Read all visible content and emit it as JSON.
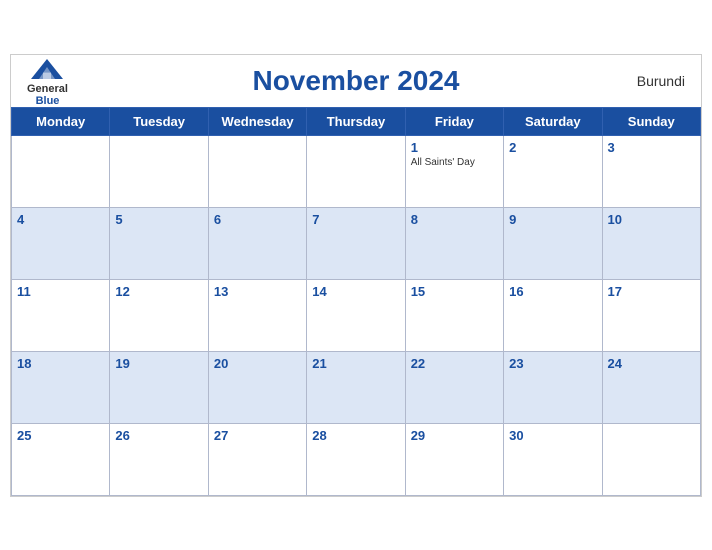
{
  "header": {
    "title": "November 2024",
    "country": "Burundi",
    "logo": {
      "general": "General",
      "blue": "Blue"
    }
  },
  "weekdays": [
    "Monday",
    "Tuesday",
    "Wednesday",
    "Thursday",
    "Friday",
    "Saturday",
    "Sunday"
  ],
  "weeks": [
    [
      {
        "day": "",
        "empty": true
      },
      {
        "day": "",
        "empty": true
      },
      {
        "day": "",
        "empty": true
      },
      {
        "day": "",
        "empty": true
      },
      {
        "day": "1",
        "event": "All Saints' Day"
      },
      {
        "day": "2"
      },
      {
        "day": "3"
      }
    ],
    [
      {
        "day": "4"
      },
      {
        "day": "5"
      },
      {
        "day": "6"
      },
      {
        "day": "7"
      },
      {
        "day": "8"
      },
      {
        "day": "9"
      },
      {
        "day": "10"
      }
    ],
    [
      {
        "day": "11"
      },
      {
        "day": "12"
      },
      {
        "day": "13"
      },
      {
        "day": "14"
      },
      {
        "day": "15"
      },
      {
        "day": "16"
      },
      {
        "day": "17"
      }
    ],
    [
      {
        "day": "18"
      },
      {
        "day": "19"
      },
      {
        "day": "20"
      },
      {
        "day": "21"
      },
      {
        "day": "22"
      },
      {
        "day": "23"
      },
      {
        "day": "24"
      }
    ],
    [
      {
        "day": "25"
      },
      {
        "day": "26"
      },
      {
        "day": "27"
      },
      {
        "day": "28"
      },
      {
        "day": "29"
      },
      {
        "day": "30"
      },
      {
        "day": "",
        "empty": true
      }
    ]
  ],
  "colors": {
    "header_bg": "#1a4fa0",
    "row_alt_bg": "#dce6f5",
    "day_number_color": "#1a4fa0"
  }
}
